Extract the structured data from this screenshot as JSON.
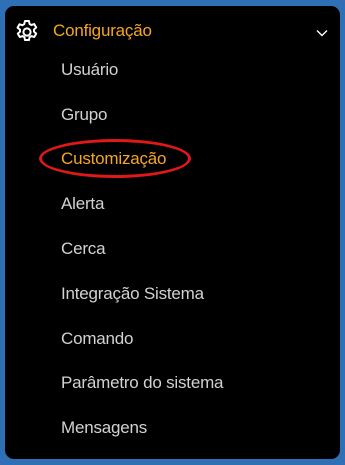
{
  "menu": {
    "title": "Configuração",
    "icon": "gear-icon",
    "expand_icon": "chevron-down-icon",
    "accent_color": "#f5a623",
    "items": [
      {
        "label": "Usuário",
        "active": false
      },
      {
        "label": "Grupo",
        "active": false
      },
      {
        "label": "Customização",
        "active": true
      },
      {
        "label": "Alerta",
        "active": false
      },
      {
        "label": "Cerca",
        "active": false
      },
      {
        "label": "Integração Sistema",
        "active": false
      },
      {
        "label": "Comando",
        "active": false
      },
      {
        "label": "Parâmetro do sistema",
        "active": false
      },
      {
        "label": "Mensagens",
        "active": false
      }
    ]
  },
  "annotation": {
    "shape": "ellipse",
    "color": "#e01818",
    "target": "Customização"
  }
}
